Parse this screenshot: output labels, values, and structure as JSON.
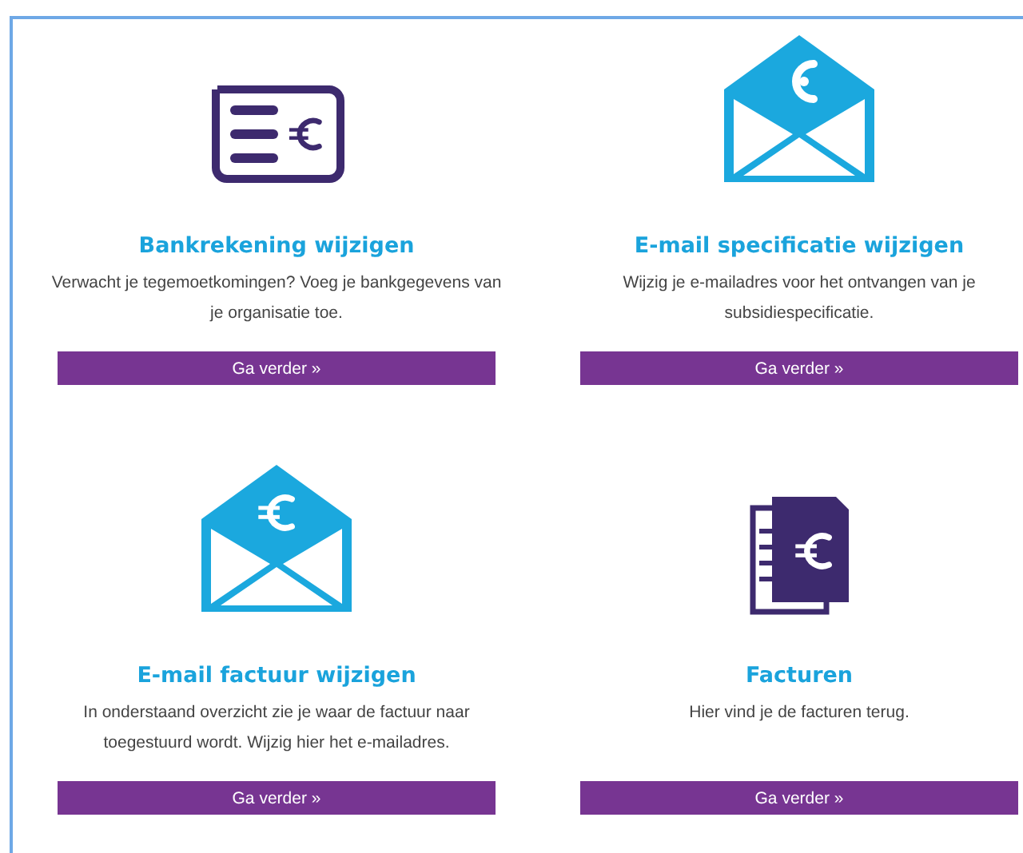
{
  "cards": [
    {
      "kind": "bank",
      "title": "Bankrekening wijzigen",
      "description": "Verwacht je tegemoetkomingen? Voeg je bankgegevens van je organisatie toe.",
      "button": "Ga verder »"
    },
    {
      "kind": "mail-at",
      "title": "E-mail specificatie wijzigen",
      "description": "Wijzig je e-mailadres voor het ontvangen van je subsidiespecificatie.",
      "button": "Ga verder »"
    },
    {
      "kind": "mail-euro",
      "title": "E-mail factuur wijzigen",
      "description": "In onderstaand overzicht zie je waar de factuur naar toegestuurd wordt. Wijzig hier het e-mailadres.",
      "button": "Ga verder »"
    },
    {
      "kind": "invoices",
      "title": "Facturen",
      "description": "Hier vind je de facturen terug.",
      "button": "Ga verder »"
    }
  ]
}
